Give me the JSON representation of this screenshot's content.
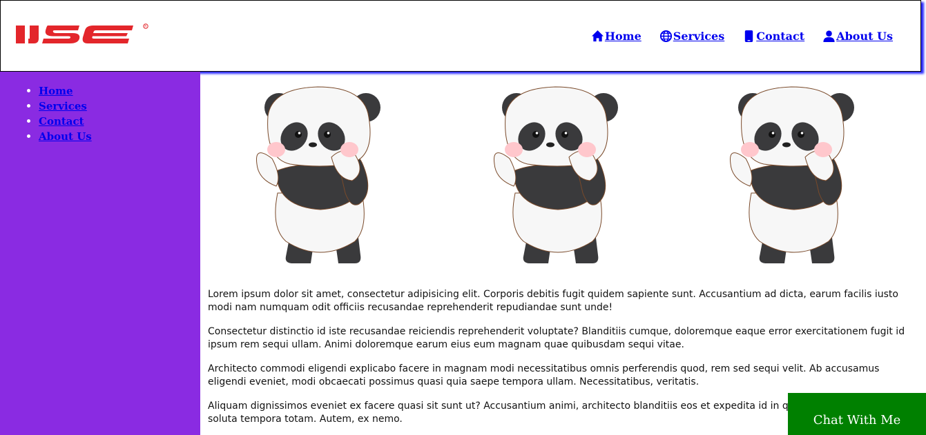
{
  "header": {
    "logo_text": "IJSE",
    "nav": [
      {
        "label": "Home",
        "icon": "home-icon"
      },
      {
        "label": "Services",
        "icon": "globe-icon"
      },
      {
        "label": "Contact",
        "icon": "phone-icon"
      },
      {
        "label": "About Us",
        "icon": "user-icon"
      }
    ]
  },
  "sidebar": {
    "items": [
      "Home",
      "Services",
      "Contact",
      "About Us"
    ]
  },
  "content": {
    "images": [
      "panda-image",
      "panda-image",
      "panda-image"
    ],
    "paragraphs": [
      "Lorem ipsum dolor sit amet, consectetur adipisicing elit. Corporis debitis fugit quidem sapiente sunt. Accusantium ad dicta, earum facilis iusto modi nam numquam odit officiis recusandae reprehenderit repudiandae sunt unde!",
      "Consectetur distinctio id iste recusandae reiciendis reprehenderit voluptate? Blanditiis cumque, doloremque eaque error exercitationem fugit id ipsum rem sequi ullam. Animi doloremque earum eius eum magnam quae quibusdam sequi vitae.",
      "Architecto commodi eligendi explicabo facere in magnam modi necessitatibus omnis perferendis quod, rem sed sequi velit. Ab accusamus eligendi eveniet, modi obcaecati possimus quasi quia saepe tempora ullam. Necessitatibus, veritatis.",
      "Aliquam dignissimos eveniet ex facere quasi sit sunt ut? Accusantium animi, architecto blanditiis eos et expedita id in quidem, recusandae saepe soluta tempora totam. Autem, ex nemo."
    ]
  },
  "chat": {
    "label": "Chat With Me"
  },
  "colors": {
    "sidebar": "#8a2be2",
    "chat": "#008000",
    "logo": "#e3262b",
    "link": "#0000ee"
  }
}
